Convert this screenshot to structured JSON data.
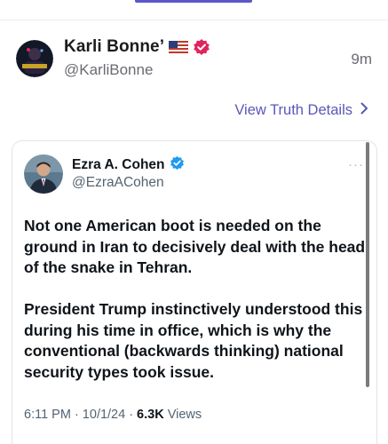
{
  "post": {
    "author_name": "Karli Bonne’",
    "author_handle": "@KarliBonne",
    "time_ago": "9m",
    "flag_icon": "us-flag-icon",
    "verified_color": "#e0245e",
    "view_details_label": "View Truth Details"
  },
  "quoted": {
    "author_name": "Ezra A. Cohen",
    "author_handle": "@EzraACohen",
    "more_label": "···",
    "paragraph_1": "Not one American boot is needed on the ground in Iran to decisively deal with the head of the snake in Tehran.",
    "paragraph_2": "President Trump instinctively understood this during his time in office, which is why the conventional (backwards thinking) national security types took issue.",
    "timestamp": "6:11 PM · 10/1/24 ·",
    "views_count": "6.3K",
    "views_label": "Views",
    "verified_color": "#1d9bf0"
  },
  "colors": {
    "accent": "#5a57b8",
    "tab_indicator": "#5b57c9"
  }
}
